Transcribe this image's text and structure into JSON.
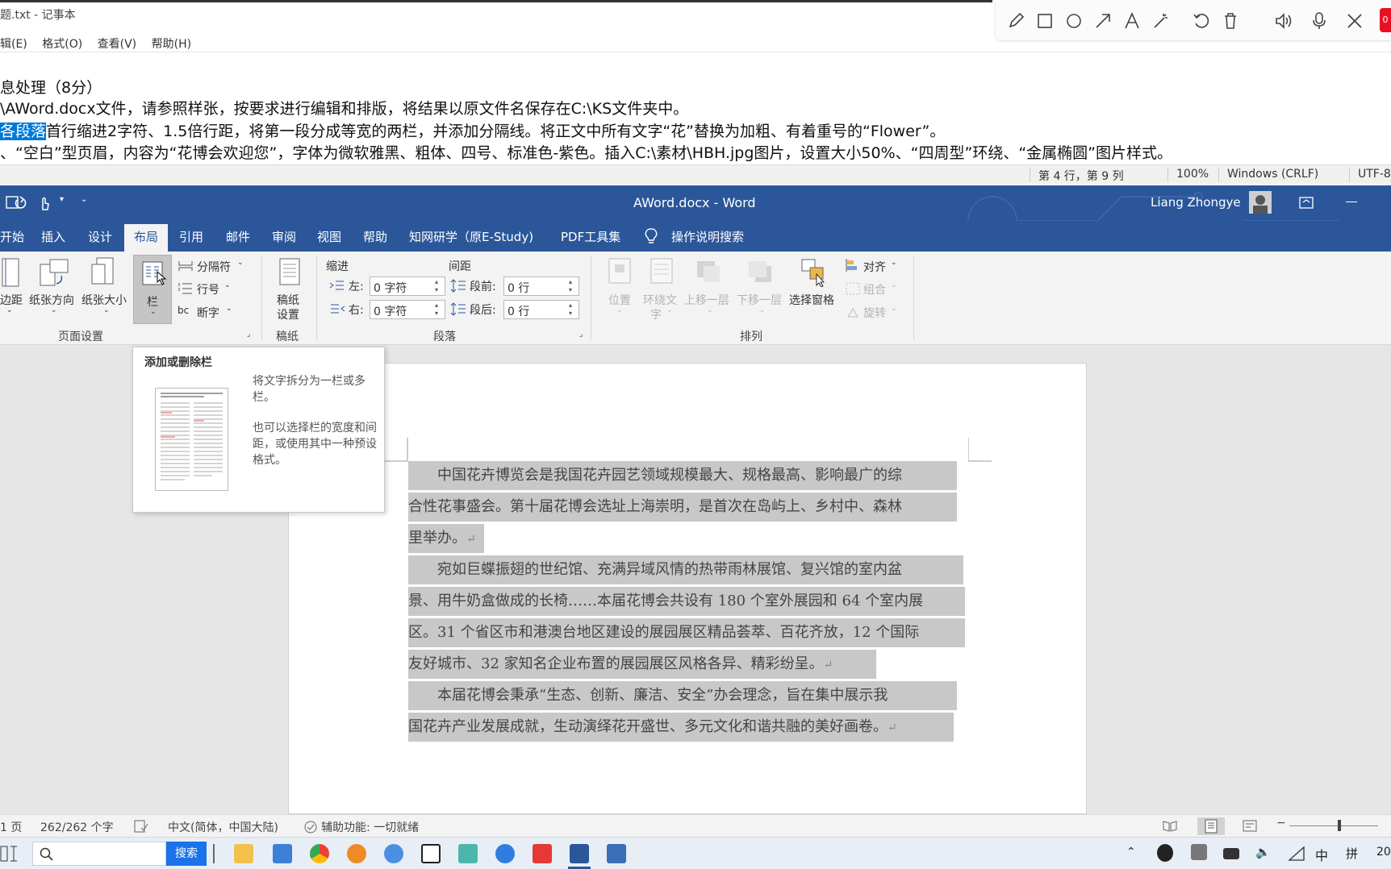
{
  "notepad": {
    "title": "题.txt - 记事本",
    "menu": [
      "辑(E)",
      "格式(O)",
      "查看(V)",
      "帮助(H)"
    ],
    "lines": [
      "息处理（8分）",
      "\\AWord.docx文件，请参照样张，按要求进行编辑和排版，将结果以原文件名保存在C:\\KS文件夹中。",
      "首行缩进2字符、1.5倍行距，将第一段分成等宽的两栏，并添加分隔线。将正文中所有文字“花”替换为加粗、有着重号的“Flower”。",
      "、“空白”型页眉，内容为“花博会欢迎您”，字体为微软雅黑、粗体、四号、标准色-紫色。插入C:\\素材\\HBH.jpg图片，设置大小50%、“四周型”环绕、“金属椭圆”图片样式。"
    ],
    "selected_text": "各段落",
    "status": {
      "position": "第 4 行，第 9 列",
      "zoom": "100%",
      "line_ending": "Windows (CRLF)",
      "encoding": "UTF-8"
    }
  },
  "annotation_toolbar": {
    "tools": [
      "pencil-icon",
      "rectangle-icon",
      "circle-icon",
      "arrow-icon",
      "text-icon",
      "magic-wand-icon",
      "undo-icon",
      "trash-icon",
      "speaker-icon",
      "microphone-icon",
      "close-icon"
    ],
    "record_label": "0"
  },
  "word": {
    "title": "AWord.docx  -  Word",
    "user": "Liang Zhongye",
    "tabs": [
      "开始",
      "插入",
      "设计",
      "布局",
      "引用",
      "邮件",
      "审阅",
      "视图",
      "帮助",
      "知网研学（原E-Study)",
      "PDF工具集"
    ],
    "active_tab": "布局",
    "search_label": "操作说明搜索",
    "ribbon": {
      "page_setup": {
        "margins": "边距",
        "orientation": "纸张方向",
        "size": "纸张大小",
        "columns": "栏",
        "breaks": "分隔符",
        "line_numbers": "行号",
        "hyphenation": "断字",
        "group": "页面设置"
      },
      "manuscript": {
        "button_line1": "稿纸",
        "button_line2": "设置",
        "group": "稿纸"
      },
      "paragraph": {
        "indent_header": "缩进",
        "spacing_header": "间距",
        "left_label": "左:",
        "left_value": "0 字符",
        "right_label": "右:",
        "right_value": "0 字符",
        "before_label": "段前:",
        "before_value": "0 行",
        "after_label": "段后:",
        "after_value": "0 行",
        "group": "段落"
      },
      "arrange": {
        "position": "位置",
        "wrap_line1": "环绕文",
        "wrap_line2": "字",
        "forward": "上移一层",
        "backward": "下移一层",
        "selection_pane": "选择窗格",
        "align": "对齐",
        "group_btn": "组合",
        "rotate": "旋转",
        "group": "排列"
      }
    },
    "tooltip": {
      "title": "添加或删除栏",
      "desc1": "将文字拆分为一栏或多栏。",
      "desc2": "也可以选择栏的宽度和间距，或使用其中一种预设格式。"
    },
    "document": {
      "lines": [
        "　　中国花卉博览会是我国花卉园艺领域规模最大、规格最高、影响最广的综",
        "合性花事盛会。第十届花博会选址上海崇明，是首次在岛屿上、乡村中、森林",
        "里举办。",
        "　　宛如巨蝶振翅的世纪馆、充满异域风情的热带雨林展馆、复兴馆的室内盆",
        "景、用牛奶盒做成的长椅……本届花博会共设有 180 个室外展园和 64 个室内展",
        "区。31 个省区市和港澳台地区建设的展园展区精品荟萃、百花齐放，12 个国际",
        "友好城市、32 家知名企业布置的展园展区风格各异、精彩纷呈。",
        "　　本届花博会秉承“生态、创新、廉洁、安全”办会理念，旨在集中展示我",
        "国花卉产业发展成就，生动演绎花开盛世、多元文化和谐共融的美好画卷。"
      ],
      "paragraph_mark": "↵"
    },
    "status": {
      "page": "1 页",
      "words": "262/262 个字",
      "language": "中文(简体，中国大陆)",
      "accessibility": "辅助功能: 一切就绪"
    }
  },
  "taskbar": {
    "search_button": "搜索",
    "tray": {
      "ime": "中",
      "ime2": "拼",
      "clock": "20"
    }
  }
}
